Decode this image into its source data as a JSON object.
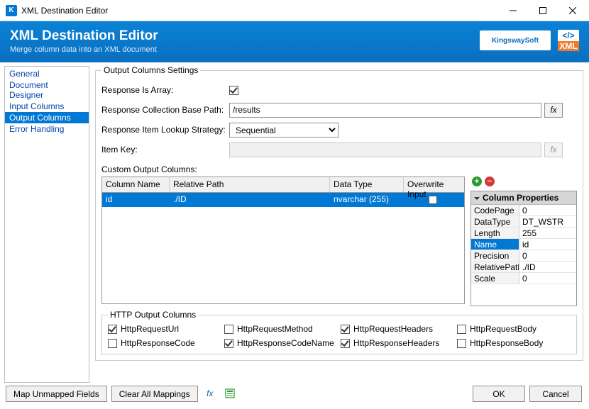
{
  "window": {
    "title": "XML Destination Editor"
  },
  "header": {
    "title": "XML Destination Editor",
    "subtitle": "Merge column data into an XML document",
    "brand_text": "KingswaySoft",
    "brand_tag_top": "</>",
    "brand_tag_bottom": "XML"
  },
  "sidebar": {
    "items": [
      {
        "label": "General"
      },
      {
        "label": "Document Designer"
      },
      {
        "label": "Input Columns"
      },
      {
        "label": "Output Columns",
        "selected": true
      },
      {
        "label": "Error Handling"
      }
    ]
  },
  "settings": {
    "legend": "Output Columns Settings",
    "labels": {
      "response_is_array": "Response Is Array:",
      "collection_base_path": "Response Collection Base Path:",
      "lookup_strategy": "Response Item Lookup Strategy:",
      "item_key": "Item Key:"
    },
    "response_is_array": true,
    "collection_base_path": "/results",
    "lookup_strategy": "Sequential",
    "item_key": "",
    "fx_label": "fx"
  },
  "custom_columns": {
    "label": "Custom Output Columns:",
    "headers": {
      "column_name": "Column Name",
      "relative_path": "Relative Path",
      "data_type": "Data Type",
      "overwrite_input": "Overwrite Input"
    },
    "rows": [
      {
        "column_name": "id",
        "relative_path": "./ID",
        "data_type": "nvarchar (255)",
        "overwrite_input": false
      }
    ]
  },
  "properties": {
    "header": "Column Properties",
    "rows": [
      {
        "key": "CodePage",
        "value": "0"
      },
      {
        "key": "DataType",
        "value": "DT_WSTR"
      },
      {
        "key": "Length",
        "value": "255"
      },
      {
        "key": "Name",
        "value": "id",
        "selected": true
      },
      {
        "key": "Precision",
        "value": "0"
      },
      {
        "key": "RelativePath",
        "value": "./ID"
      },
      {
        "key": "Scale",
        "value": "0"
      }
    ],
    "add_icon": "+",
    "remove_icon": "−"
  },
  "http": {
    "legend": "HTTP Output Columns",
    "items": [
      {
        "label": "HttpRequestUrl",
        "checked": true
      },
      {
        "label": "HttpRequestMethod",
        "checked": false
      },
      {
        "label": "HttpRequestHeaders",
        "checked": true
      },
      {
        "label": "HttpRequestBody",
        "checked": false
      },
      {
        "label": "HttpResponseCode",
        "checked": false
      },
      {
        "label": "HttpResponseCodeName",
        "checked": true
      },
      {
        "label": "HttpResponseHeaders",
        "checked": true
      },
      {
        "label": "HttpResponseBody",
        "checked": false
      }
    ]
  },
  "footer": {
    "map_unmapped": "Map Unmapped Fields",
    "clear_all": "Clear All Mappings",
    "ok": "OK",
    "cancel": "Cancel"
  }
}
